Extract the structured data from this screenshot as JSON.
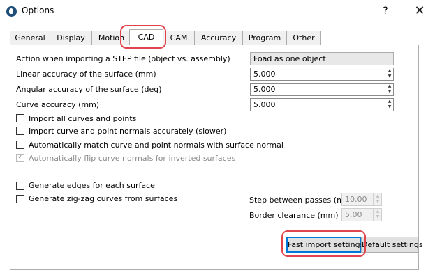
{
  "window": {
    "title": "Options",
    "help_label": "?",
    "close_label": "✕"
  },
  "tabs": [
    {
      "label": "General"
    },
    {
      "label": "Display"
    },
    {
      "label": "Motion"
    },
    {
      "label": "CAD"
    },
    {
      "label": "CAM"
    },
    {
      "label": "Accuracy"
    },
    {
      "label": "Program"
    },
    {
      "label": "Other"
    }
  ],
  "cad": {
    "import_mode": {
      "label": "Action when importing a STEP file (object vs. assembly)",
      "value": "Load as one object"
    },
    "linear_accuracy": {
      "label": "Linear accuracy of the surface (mm)",
      "value": "5.000"
    },
    "angular_accuracy": {
      "label": "Angular accuracy of the surface (deg)",
      "value": "5.000"
    },
    "curve_accuracy": {
      "label": "Curve accuracy (mm)",
      "value": "5.000"
    },
    "checkboxes": [
      {
        "label": "Import all curves and points",
        "checked": false,
        "enabled": true
      },
      {
        "label": "Import curve and point normals accurately (slower)",
        "checked": false,
        "enabled": true
      },
      {
        "label": "Automatically match curve and point normals with surface normal",
        "checked": false,
        "enabled": true
      },
      {
        "label": "Automatically flip curve normals for inverted surfaces",
        "checked": true,
        "enabled": false
      },
      {
        "label": "Generate edges for each surface",
        "checked": false,
        "enabled": true
      },
      {
        "label": "Generate zig-zag curves from surfaces",
        "checked": false,
        "enabled": true
      }
    ],
    "step_between_passes": {
      "label": "Step between passes (mm)",
      "value": "10.00"
    },
    "border_clearance": {
      "label": "Border clearance (mm)",
      "value": "5.00"
    }
  },
  "buttons": {
    "fast_import": "Fast import settings",
    "default_settings": "Default settings"
  },
  "colors": {
    "highlight": "#e0454e",
    "focus": "#0078d7"
  }
}
